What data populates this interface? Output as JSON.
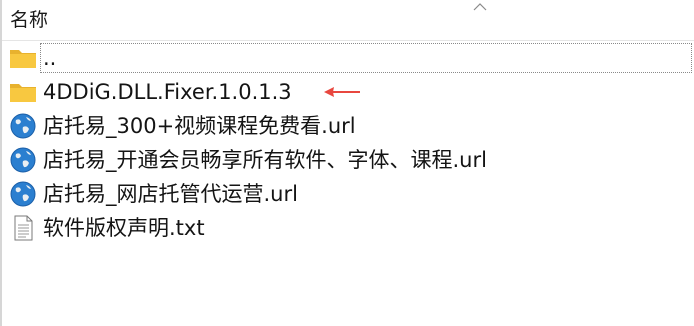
{
  "header": {
    "column_name": "名称",
    "sort_icon": "chevron-up-icon"
  },
  "files": [
    {
      "name": "..",
      "icon": "folder-icon"
    },
    {
      "name": "4DDiG.DLL.Fixer.1.0.1.3",
      "icon": "folder-icon",
      "annotation": "red-arrow-icon"
    },
    {
      "name": "店托易_300+视频课程免费看.url",
      "icon": "internet-shortcut-icon"
    },
    {
      "name": "店托易_开通会员畅享所有软件、字体、课程.url",
      "icon": "internet-shortcut-icon"
    },
    {
      "name": "店托易_网店托管代运营.url",
      "icon": "internet-shortcut-icon"
    },
    {
      "name": "软件版权声明.txt",
      "icon": "text-file-icon"
    }
  ],
  "colors": {
    "folder": "#f8c840",
    "annotation_arrow": "#e8473f",
    "globe": "#2b7fd0"
  }
}
